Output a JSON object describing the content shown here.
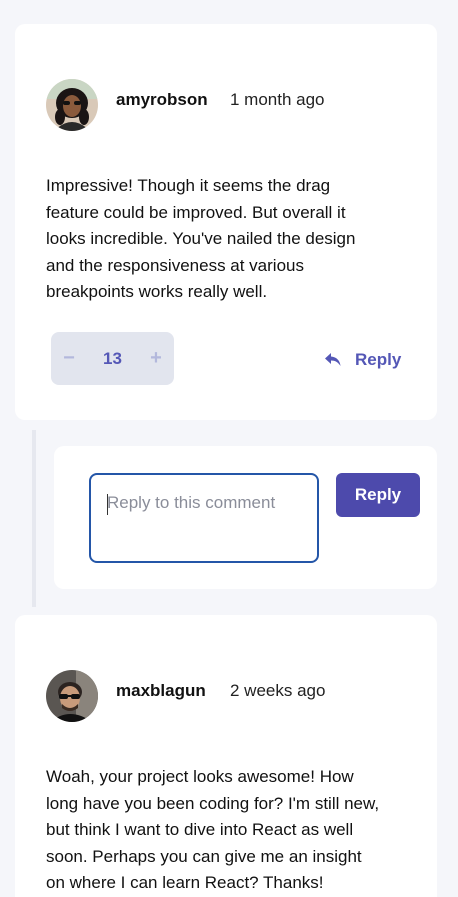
{
  "comments": [
    {
      "username": "amyrobson",
      "time_ago": "1 month ago",
      "body_lines": [
        "Impressive! Though it seems the drag",
        "feature could be improved. But overall it",
        "looks incredible. You've nailed the design",
        "and the responsiveness at various",
        "breakpoints works really well."
      ],
      "score": "13",
      "minus_label": "−",
      "plus_label": "+",
      "reply_label": "Reply"
    },
    {
      "username": "maxblagun",
      "time_ago": "2 weeks ago",
      "body_lines": [
        "Woah, your project looks awesome! How",
        "long have you been coding for? I'm still new,",
        "but think I want to dive into React as well",
        "soon. Perhaps you can give me an insight",
        "on where I can learn React? Thanks!"
      ]
    }
  ],
  "reply_form": {
    "placeholder": "Reply to this comment",
    "value": "",
    "submit_label": "Reply"
  },
  "colors": {
    "accent": "#5457b6",
    "button": "#4d4aac",
    "background": "#f5f6fa",
    "vote_bg": "#e2e5ee",
    "input_border": "#2456a8"
  }
}
